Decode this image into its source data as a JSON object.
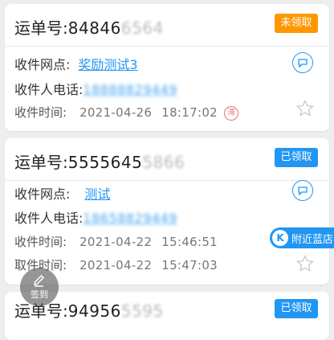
{
  "colors": {
    "accent": "#2196f3",
    "orange_badge": "#ff9800",
    "blue_badge": "#2196f3",
    "urgent": "#e57373"
  },
  "cards": [
    {
      "waybill_label": "运单号:",
      "waybill_number": "84846",
      "waybill_masked": "6564",
      "status": "未领取",
      "status_color": "#ff9800",
      "outlet_label": "收件网点:",
      "outlet_name": "奖励测试3",
      "phone_label": "收件人电话:",
      "phone_value": "18888829449",
      "receive_time_label": "收件时间:",
      "receive_date": "2021-04-26",
      "receive_time": "18:17:02",
      "urgent_tag": "滞",
      "chat_icon": "chat-bubble-icon",
      "star_icon": "star-outline-icon"
    },
    {
      "waybill_label": "运单号:",
      "waybill_number": "5555645",
      "waybill_masked": "5866",
      "status": "已领取",
      "status_color": "#2196f3",
      "outlet_label": "收件网点:",
      "outlet_name": "测试",
      "phone_label": "收件人电话:",
      "phone_value": "18658829449",
      "receive_time_label": "收件时间:",
      "receive_date": "2021-04-22",
      "receive_time": "15:46:51",
      "pickup_time_label": "取件时间:",
      "pickup_date": "2021-04-22",
      "pickup_time": "15:47:03",
      "chat_icon": "chat-bubble-icon",
      "star_icon": "star-outline-icon"
    },
    {
      "waybill_label": "运单号:",
      "waybill_number": "94956",
      "waybill_masked": "5595",
      "status": "已领取",
      "status_color": "#2196f3"
    }
  ],
  "floating": {
    "nearby_label": "附近蓝店",
    "nearby_icon": "location-k-icon",
    "sign_label": "签到",
    "sign_icon": "pencil-icon"
  }
}
